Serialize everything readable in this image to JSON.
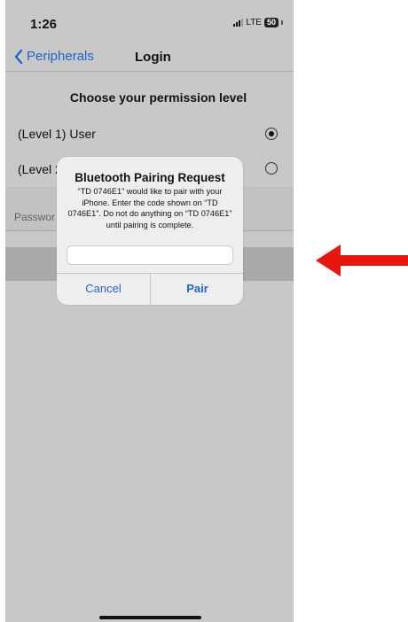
{
  "status_bar": {
    "time": "1:26",
    "network": "LTE",
    "battery": "50"
  },
  "nav": {
    "back_label": "Peripherals",
    "title": "Login"
  },
  "permission": {
    "heading": "Choose your permission level",
    "options": [
      {
        "label": "(Level 1) User",
        "selected": true
      },
      {
        "label": "(Level 2",
        "selected": false
      }
    ]
  },
  "password": {
    "placeholder": "Passwor"
  },
  "dialog": {
    "title": "Bluetooth Pairing Request",
    "message": "“TD 0746E1” would like to pair with your iPhone. Enter the code shown on “TD 0746E1”. Do not do anything on “TD 0746E1” until pairing is complete.",
    "input_value": "",
    "cancel_label": "Cancel",
    "pair_label": "Pair"
  },
  "colors": {
    "accent": "#1f66c9",
    "annotation_arrow": "#e8160c",
    "overlay": "#c8c8c8"
  },
  "icons": {
    "back": "chevron-left-icon",
    "annotation": "red-arrow-icon"
  }
}
